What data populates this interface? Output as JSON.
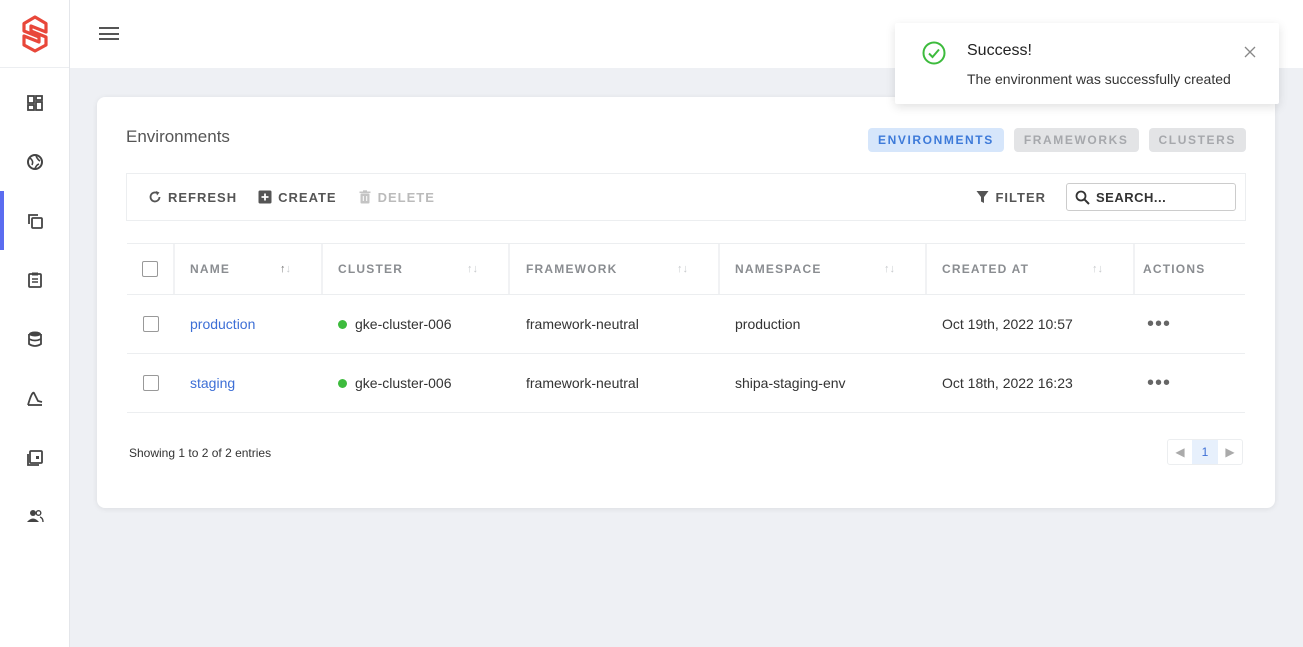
{
  "app": {
    "logo_icon": "shipa-logo-icon",
    "brand_color": "#e8473a",
    "accent": "#5b6cf0"
  },
  "sidebar": {
    "items": [
      {
        "icon": "dashboard-icon",
        "active": false
      },
      {
        "icon": "globe-icon",
        "active": false
      },
      {
        "icon": "copy-icon",
        "active": true
      },
      {
        "icon": "clipboard-icon",
        "active": false
      },
      {
        "icon": "database-icon",
        "active": false
      },
      {
        "icon": "chart-icon",
        "active": false
      },
      {
        "icon": "calendar-icon",
        "active": false
      },
      {
        "icon": "users-icon",
        "active": false
      }
    ]
  },
  "topbar": {
    "menu_icon": "hamburger-icon"
  },
  "page": {
    "title": "Environments",
    "tabs": [
      {
        "label": "ENVIRONMENTS",
        "active": true
      },
      {
        "label": "FRAMEWORKS",
        "active": false
      },
      {
        "label": "CLUSTERS",
        "active": false
      }
    ]
  },
  "toolbar": {
    "refresh_label": "REFRESH",
    "create_label": "CREATE",
    "delete_label": "DELETE",
    "filter_label": "FILTER",
    "search_placeholder": "SEARCH..."
  },
  "table": {
    "columns": [
      "NAME",
      "CLUSTER",
      "FRAMEWORK",
      "NAMESPACE",
      "CREATED AT",
      "ACTIONS"
    ],
    "rows": [
      {
        "name": "production",
        "cluster": "gke-cluster-006",
        "framework": "framework-neutral",
        "namespace": "production",
        "created_at": "Oct 19th, 2022 10:57",
        "actions": "•••"
      },
      {
        "name": "staging",
        "cluster": "gke-cluster-006",
        "framework": "framework-neutral",
        "namespace": "shipa-staging-env",
        "created_at": "Oct 18th, 2022 16:23",
        "actions": "•••"
      }
    ],
    "sort_indicator": "↑↓"
  },
  "footer": {
    "entries_text": "Showing 1 to 2 of 2 entries",
    "current_page": "1"
  },
  "toast": {
    "title": "Success!",
    "message": "The environment was successfully created",
    "status_color": "#3dbb3d"
  }
}
